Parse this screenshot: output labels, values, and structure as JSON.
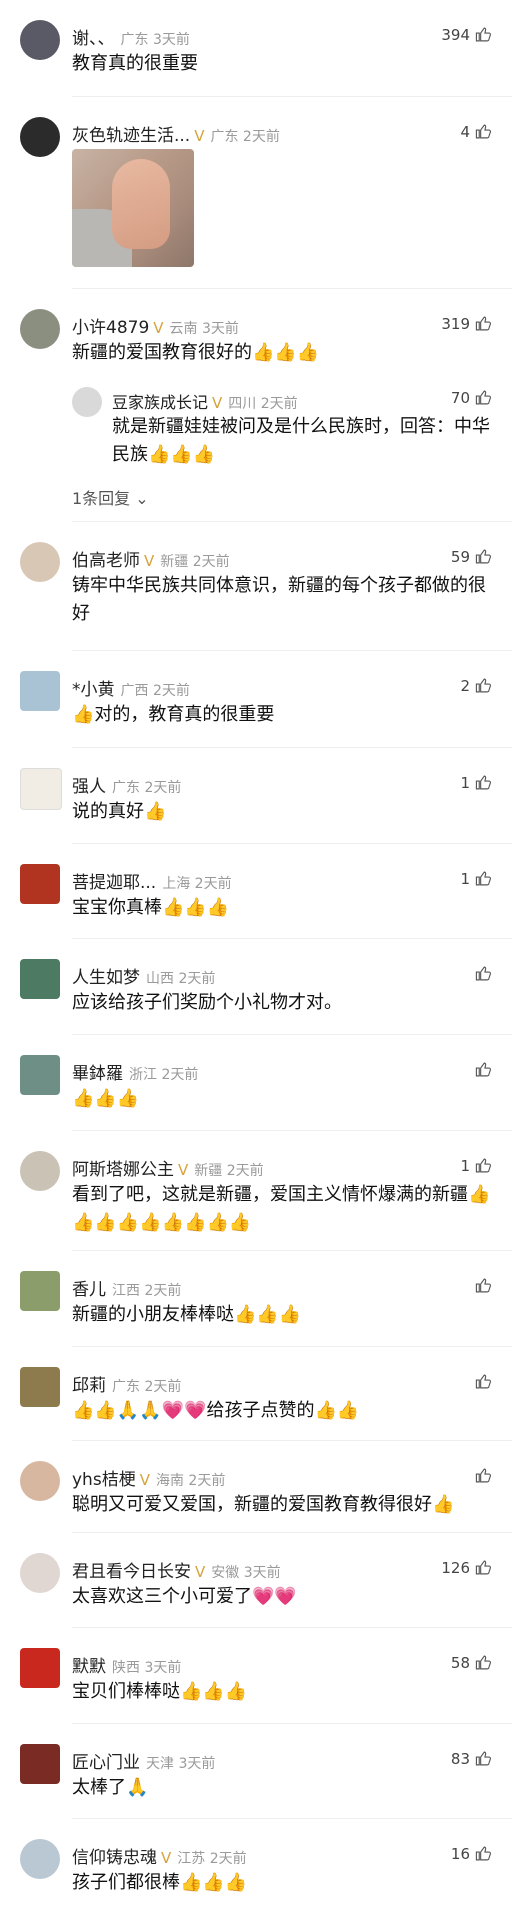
{
  "comments": [
    {
      "name": "谢、、",
      "loc": "广东 3天前",
      "likes": "394",
      "text": "教育真的很重要",
      "badge": false,
      "avatarColor": "#5a5a66"
    },
    {
      "name": "灰色轨迹生活...",
      "loc": "广东 2天前",
      "likes": "4",
      "text": "",
      "badge": true,
      "avatarColor": "#2b2b2b",
      "hasImage": true
    },
    {
      "name": "小许4879",
      "loc": "云南 3天前",
      "likes": "319",
      "text": "新疆的爱国教育很好的👍👍👍",
      "badge": true,
      "avatarColor": "#8b8f80",
      "reply": {
        "name": "豆家族成长记",
        "loc": "四川 2天前",
        "likes": "70",
        "text": "就是新疆娃娃被问及是什么民族时，回答：中华民族👍👍👍",
        "badge": true
      },
      "more": "1条回复"
    },
    {
      "name": "伯高老师",
      "loc": "新疆 2天前",
      "likes": "59",
      "text": "铸牢中华民族共同体意识，新疆的每个孩子都做的很好",
      "badge": true,
      "avatarColor": "#d9c7b5"
    },
    {
      "name": "*小黄",
      "loc": "广西 2天前",
      "likes": "2",
      "text": "👍对的，教育真的很重要",
      "badge": false,
      "avatarColor": "#a9c3d4"
    },
    {
      "name": "强人",
      "loc": "广东 2天前",
      "likes": "1",
      "text": "说的真好👍",
      "badge": false,
      "avatarColor": "#f1ece4"
    },
    {
      "name": "菩提迦耶...",
      "loc": "上海 2天前",
      "likes": "1",
      "text": "宝宝你真棒👍👍👍",
      "badge": false,
      "avatarColor": "#b0341f"
    },
    {
      "name": "人生如梦",
      "loc": "山西 2天前",
      "likes": "",
      "text": "应该给孩子们奖励个小礼物才对。",
      "badge": false,
      "avatarColor": "#4d7a63"
    },
    {
      "name": "畢鉢羅",
      "loc": "浙江 2天前",
      "likes": "",
      "text": "👍👍👍",
      "badge": false,
      "avatarColor": "#6e8f86"
    },
    {
      "name": "阿斯塔娜公主",
      "loc": "新疆 2天前",
      "likes": "1",
      "text": "看到了吧，这就是新疆，爱国主义情怀爆满的新疆👍👍👍👍👍👍👍👍👍",
      "badge": true,
      "avatarColor": "#c9c2b5"
    },
    {
      "name": "香儿",
      "loc": "江西 2天前",
      "likes": "",
      "text": "新疆的小朋友棒棒哒👍👍👍",
      "badge": false,
      "avatarColor": "#8a9d6b"
    },
    {
      "name": "邱莉",
      "loc": "广东 2天前",
      "likes": "",
      "text": "👍👍🙏🙏💗💗给孩子点赞的👍👍",
      "badge": false,
      "avatarColor": "#8d7b4e"
    },
    {
      "name": "yhs桔梗",
      "loc": "海南 2天前",
      "likes": "",
      "text": "聪明又可爱又爱国，新疆的爱国教育教得很好👍",
      "badge": true,
      "avatarColor": "#d8b7a0"
    },
    {
      "name": "君且看今日长安",
      "loc": "安徽 3天前",
      "likes": "126",
      "text": "太喜欢这三个小可爱了💗💗",
      "badge": true,
      "avatarColor": "#e0d6d2"
    },
    {
      "name": "默默",
      "loc": "陕西 3天前",
      "likes": "58",
      "text": "宝贝们棒棒哒👍👍👍",
      "badge": false,
      "avatarColor": "#c8281e"
    },
    {
      "name": "匠心门业",
      "loc": "天津 3天前",
      "likes": "83",
      "text": "太棒了🙏",
      "badge": false,
      "avatarColor": "#7a2b24"
    },
    {
      "name": "信仰铸忠魂",
      "loc": "江苏 2天前",
      "likes": "16",
      "text": "孩子们都很棒👍👍👍",
      "badge": true,
      "avatarColor": "#b9c8d3"
    }
  ],
  "icons": {
    "like": "thumbs-up-icon",
    "badge": "vip-badge-icon",
    "expand": "chevron-down-icon"
  }
}
